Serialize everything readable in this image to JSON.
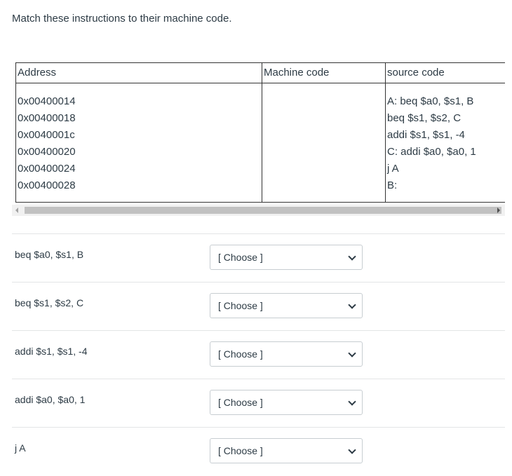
{
  "question": "Match these instructions to their machine code.",
  "table": {
    "headers": [
      "Address",
      "Machine code",
      "source code"
    ],
    "addresses": [
      "0x00400014",
      "0x00400018",
      "0x0040001c",
      "0x00400020",
      "0x00400024",
      "0x00400028"
    ],
    "source": [
      "A: beq $a0, $s1, B",
      "beq $s1, $s2, C",
      "addi $s1, $s1, -4",
      "C: addi $a0, $a0, 1",
      "j A",
      "B:"
    ]
  },
  "matches": [
    {
      "label": "beq $a0, $s1, B",
      "selected": "[ Choose ]"
    },
    {
      "label": "beq $s1, $s2, C",
      "selected": "[ Choose ]"
    },
    {
      "label": "addi $s1, $s1, -4",
      "selected": "[ Choose ]"
    },
    {
      "label": "addi $a0, $a0, 1",
      "selected": "[ Choose ]"
    },
    {
      "label": "j A",
      "selected": "[ Choose ]"
    }
  ]
}
